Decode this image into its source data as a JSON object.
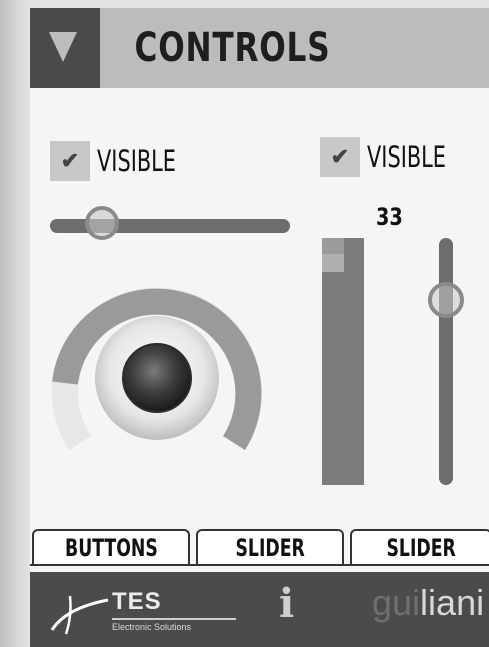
{
  "header": {
    "title": "CONTROLS",
    "menu_icon": "triangle-down-icon"
  },
  "left_column": {
    "checkbox": {
      "label": "VISIBLE",
      "checked": true
    },
    "horizontal_slider": {
      "value_fraction": 0.2
    },
    "knob": {
      "value_fraction": 0.5,
      "icon": "round-knob"
    }
  },
  "right_column": {
    "checkbox": {
      "label": "VISIBLE",
      "checked": true
    },
    "value_readout": "33",
    "level_bar": {
      "value_fraction": 1.0
    },
    "vertical_slider": {
      "value_fraction": 0.75
    }
  },
  "tabs": [
    {
      "label": "BUTTONS"
    },
    {
      "label": "SLIDER"
    },
    {
      "label": "SLIDER"
    }
  ],
  "footer": {
    "logo_name": "TES",
    "logo_subtitle": "Electronic Solutions",
    "info_glyph": "i",
    "brand_part1": "gui",
    "brand_part2": "liani"
  },
  "colors": {
    "header_bg": "#bcbcbc",
    "header_button_bg": "#4a4a4a",
    "panel_bg": "#f5f5f5",
    "footer_bg": "#4b4b4b"
  }
}
